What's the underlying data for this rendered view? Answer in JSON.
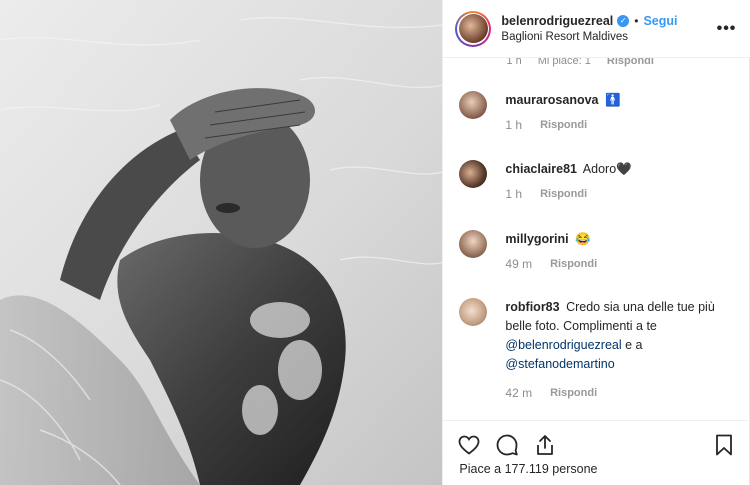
{
  "header": {
    "username": "belenrodriguezreal",
    "separator": "•",
    "follow_label": "Segui",
    "location": "Baglioni Resort Maldives",
    "more_label": "•••"
  },
  "partial_comment": {
    "time": "1 h",
    "likes": "Mi piace: 1",
    "reply": "Rispondi"
  },
  "comments": [
    {
      "user": "maurarosanova",
      "text": "",
      "emoji": "🚹",
      "time": "1 h",
      "reply": "Rispondi"
    },
    {
      "user": "chiaclaire81",
      "text": "Adoro",
      "emoji": "🖤",
      "time": "1 h",
      "reply": "Rispondi"
    },
    {
      "user": "millygorini",
      "text": "",
      "emoji": "😂",
      "time": "49 m",
      "reply": "Rispondi"
    },
    {
      "user": "robfior83",
      "text": "Credo sia una delle tue più belle foto. Complimenti a te",
      "mention1": "@belenrodriguezreal",
      "conj": "e a",
      "mention2": "@stefanodemartino",
      "time": "42 m",
      "reply": "Rispondi"
    }
  ],
  "actions": {
    "likes_text": "Piace a 177.119 persone"
  },
  "colors": {
    "accent": "#3897f0",
    "muted": "#8e8e8e",
    "text": "#262626",
    "mention": "#003569"
  },
  "icons": [
    "verified-badge-icon",
    "heart-icon",
    "comment-icon",
    "share-icon",
    "bookmark-icon",
    "more-icon"
  ]
}
